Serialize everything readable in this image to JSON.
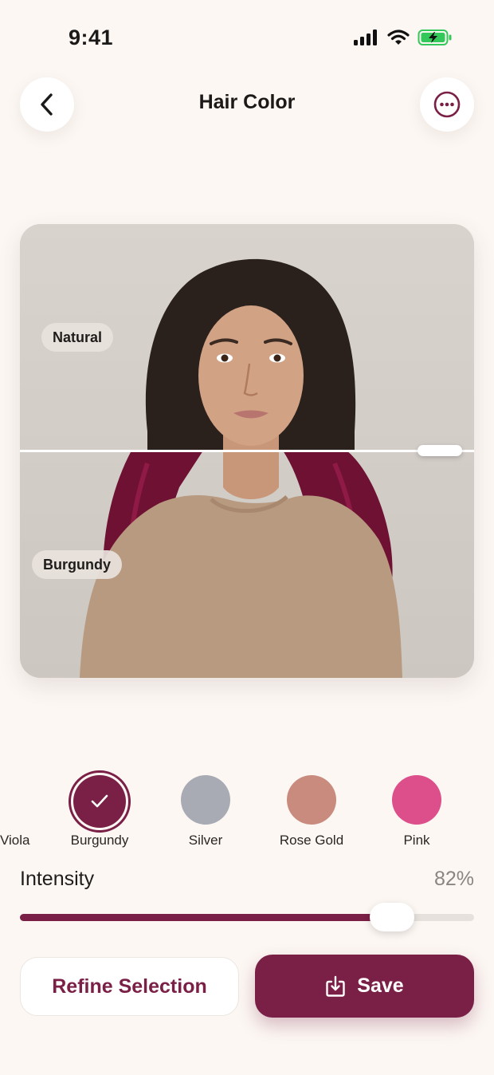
{
  "status_bar": {
    "time": "9:41"
  },
  "header": {
    "title": "Hair Color"
  },
  "preview": {
    "top_label": "Natural",
    "bottom_label": "Burgundy",
    "split_position": 0.5
  },
  "swatches": {
    "clipped_label": "Viola",
    "items": [
      {
        "label": "Burgundy",
        "color": "#7a1f45",
        "selected": true
      },
      {
        "label": "Silver",
        "color": "#a8abb4",
        "selected": false
      },
      {
        "label": "Rose Gold",
        "color": "#c98b7e",
        "selected": false
      },
      {
        "label": "Pink",
        "color": "#dc4f8a",
        "selected": false
      }
    ]
  },
  "intensity": {
    "label": "Intensity",
    "value_text": "82%",
    "value": 0.82
  },
  "actions": {
    "refine_label": "Refine Selection",
    "save_label": "Save"
  },
  "colors": {
    "accent": "#7a1f45",
    "background": "#fcf7f3"
  }
}
